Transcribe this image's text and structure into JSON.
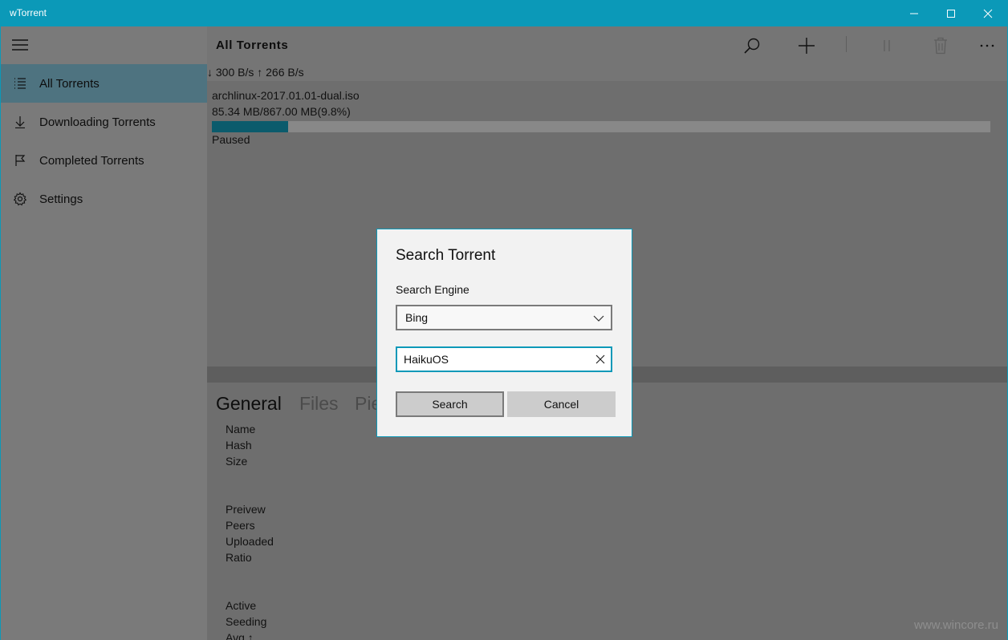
{
  "window": {
    "title": "wTorrent",
    "controls": {
      "minimize": "minimize-icon",
      "maximize": "maximize-icon",
      "close": "close-icon"
    }
  },
  "sidebar": {
    "menu_icon": "hamburger-icon",
    "items": [
      {
        "label": "All Torrents",
        "icon": "list-icon",
        "active": true
      },
      {
        "label": "Downloading Torrents",
        "icon": "download-arrow-icon",
        "active": false
      },
      {
        "label": "Completed Torrents",
        "icon": "flag-icon",
        "active": false
      },
      {
        "label": "Settings",
        "icon": "gear-icon",
        "active": false
      }
    ]
  },
  "header": {
    "title": "All Torrents",
    "speed": "↓ 300 B/s ↑ 266 B/s",
    "toolbar": [
      "search-icon",
      "add-icon",
      "pause-icon",
      "delete-icon",
      "more-icon"
    ]
  },
  "torrents": [
    {
      "name": "archlinux-2017.01.01-dual.iso",
      "size": "85.34 MB/867.00 MB(9.8%)",
      "progress": 0.098,
      "status": "Paused"
    }
  ],
  "details": {
    "tabs": [
      "General",
      "Files",
      "Pie"
    ],
    "fields": [
      "Name",
      "Hash",
      "Size",
      "Preivew",
      "Peers",
      "Uploaded",
      "Ratio",
      "Active",
      "Seeding",
      "Avg ↑"
    ]
  },
  "dialog": {
    "title": "Search Torrent",
    "engine_label": "Search Engine",
    "engine_value": "Bing",
    "query": "HaikuOS",
    "search_button": "Search",
    "cancel_button": "Cancel"
  },
  "watermark": "www.wincore.ru",
  "colors": {
    "accent": "#0b99b8",
    "sidebar_active": "#4e7380",
    "progress_fill": "#0b5b6c",
    "dialog_bg": "#f2f2f2"
  }
}
